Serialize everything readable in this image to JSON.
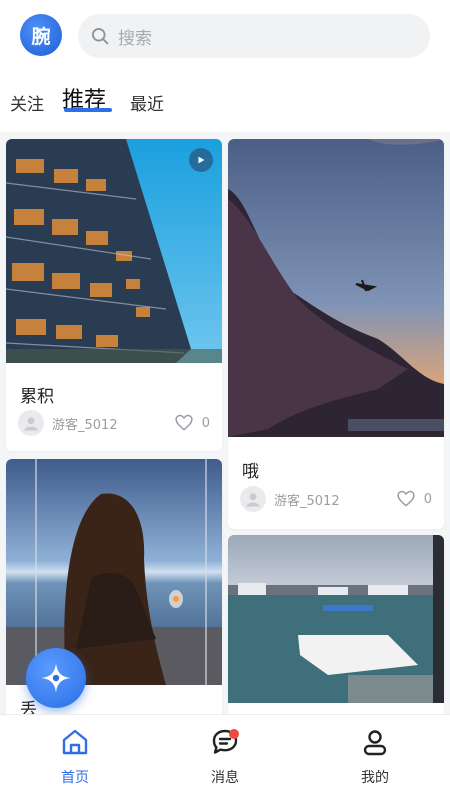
{
  "header": {
    "logo_text": "腕",
    "search_placeholder": "搜索"
  },
  "tabs": [
    {
      "label": "关注"
    },
    {
      "label": "推荐",
      "active": true
    },
    {
      "label": "最近"
    }
  ],
  "feed": {
    "left": [
      {
        "title": "累积",
        "author": "游客_5012",
        "likes": "0",
        "video": true
      },
      {
        "title": "丢",
        "author": "",
        "likes": ""
      }
    ],
    "right": [
      {
        "title": "哦",
        "author": "游客_5012",
        "likes": "0"
      },
      {
        "title": "",
        "author": "",
        "likes": ""
      }
    ]
  },
  "bottom_nav": [
    {
      "label": "首页",
      "active": true,
      "icon": "home-icon"
    },
    {
      "label": "消息",
      "icon": "message-icon",
      "badge": true
    },
    {
      "label": "我的",
      "icon": "user-icon"
    }
  ],
  "colors": {
    "accent": "#2f6fe6",
    "badge": "#f04a3e",
    "background": "#f4f5f7"
  }
}
